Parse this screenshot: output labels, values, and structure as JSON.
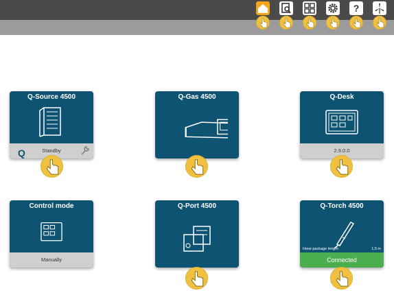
{
  "nav": {
    "buttons": [
      {
        "name": "home-button",
        "icon": "home-icon",
        "active": true
      },
      {
        "name": "search-button",
        "icon": "document-search-icon",
        "active": false
      },
      {
        "name": "modules-button",
        "icon": "modules-grid-icon",
        "active": false
      },
      {
        "name": "settings-button",
        "icon": "gear-icon",
        "active": false
      },
      {
        "name": "help-button",
        "icon": "question-icon",
        "active": false
      },
      {
        "name": "fan-button",
        "icon": "fan-icon",
        "active": false
      }
    ]
  },
  "tiles": {
    "qsource": {
      "title": "Q-Source 4500",
      "logo": "Q",
      "status": "Standby",
      "icon": "power-source-icon",
      "tool_icon": "wrench-icon"
    },
    "qgas": {
      "title": "Q-Gas 4500",
      "icon": "gas-unit-icon"
    },
    "qdesk": {
      "title": "Q-Desk",
      "version": "2.9.0.0",
      "icon": "desk-monitor-icon"
    },
    "control": {
      "title": "Control mode",
      "mode": "Manually",
      "icon": "control-panel-icon"
    },
    "qport": {
      "title": "Q-Port 4500",
      "icon": "port-unit-icon"
    },
    "qtorch": {
      "title": "Q-Torch 4500",
      "hose_label": "Hose package length",
      "hose_value": "1,5 m",
      "status": "Connected",
      "icon": "torch-icon"
    }
  },
  "colors": {
    "tile": "#0e5372",
    "topbar": "#4a4a4a",
    "subbar": "#9b9b9b",
    "accent": "#f3a61b",
    "connected": "#4caf4f",
    "hand": "#f0c141"
  }
}
